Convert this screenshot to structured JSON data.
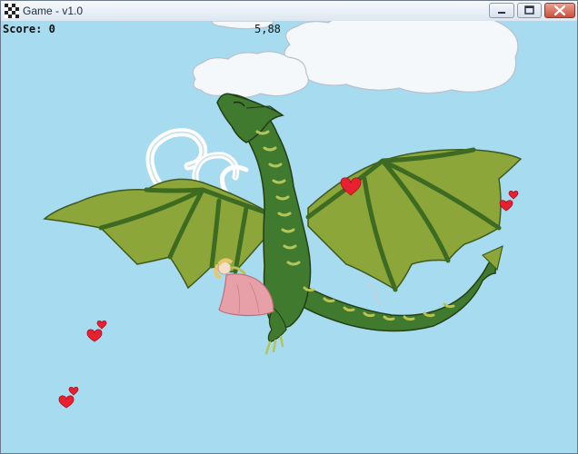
{
  "window": {
    "title": "Game - v1.0",
    "controls": {
      "minimize_icon": "minimize-icon",
      "maximize_icon": "maximize-icon",
      "close_icon": "close-icon"
    }
  },
  "hud": {
    "score_text": "Score: 0",
    "counter_text": "5,88"
  },
  "scene": {
    "sky_color": "#a7dbf0",
    "dragon_color": "#3f7a2e",
    "wing_color": "#8da63a",
    "heart_color": "#e8202f",
    "dress_color": "#e8a0a8",
    "sprites": [
      "cloud",
      "dragon",
      "princess",
      "heart",
      "wind-swirl"
    ]
  }
}
